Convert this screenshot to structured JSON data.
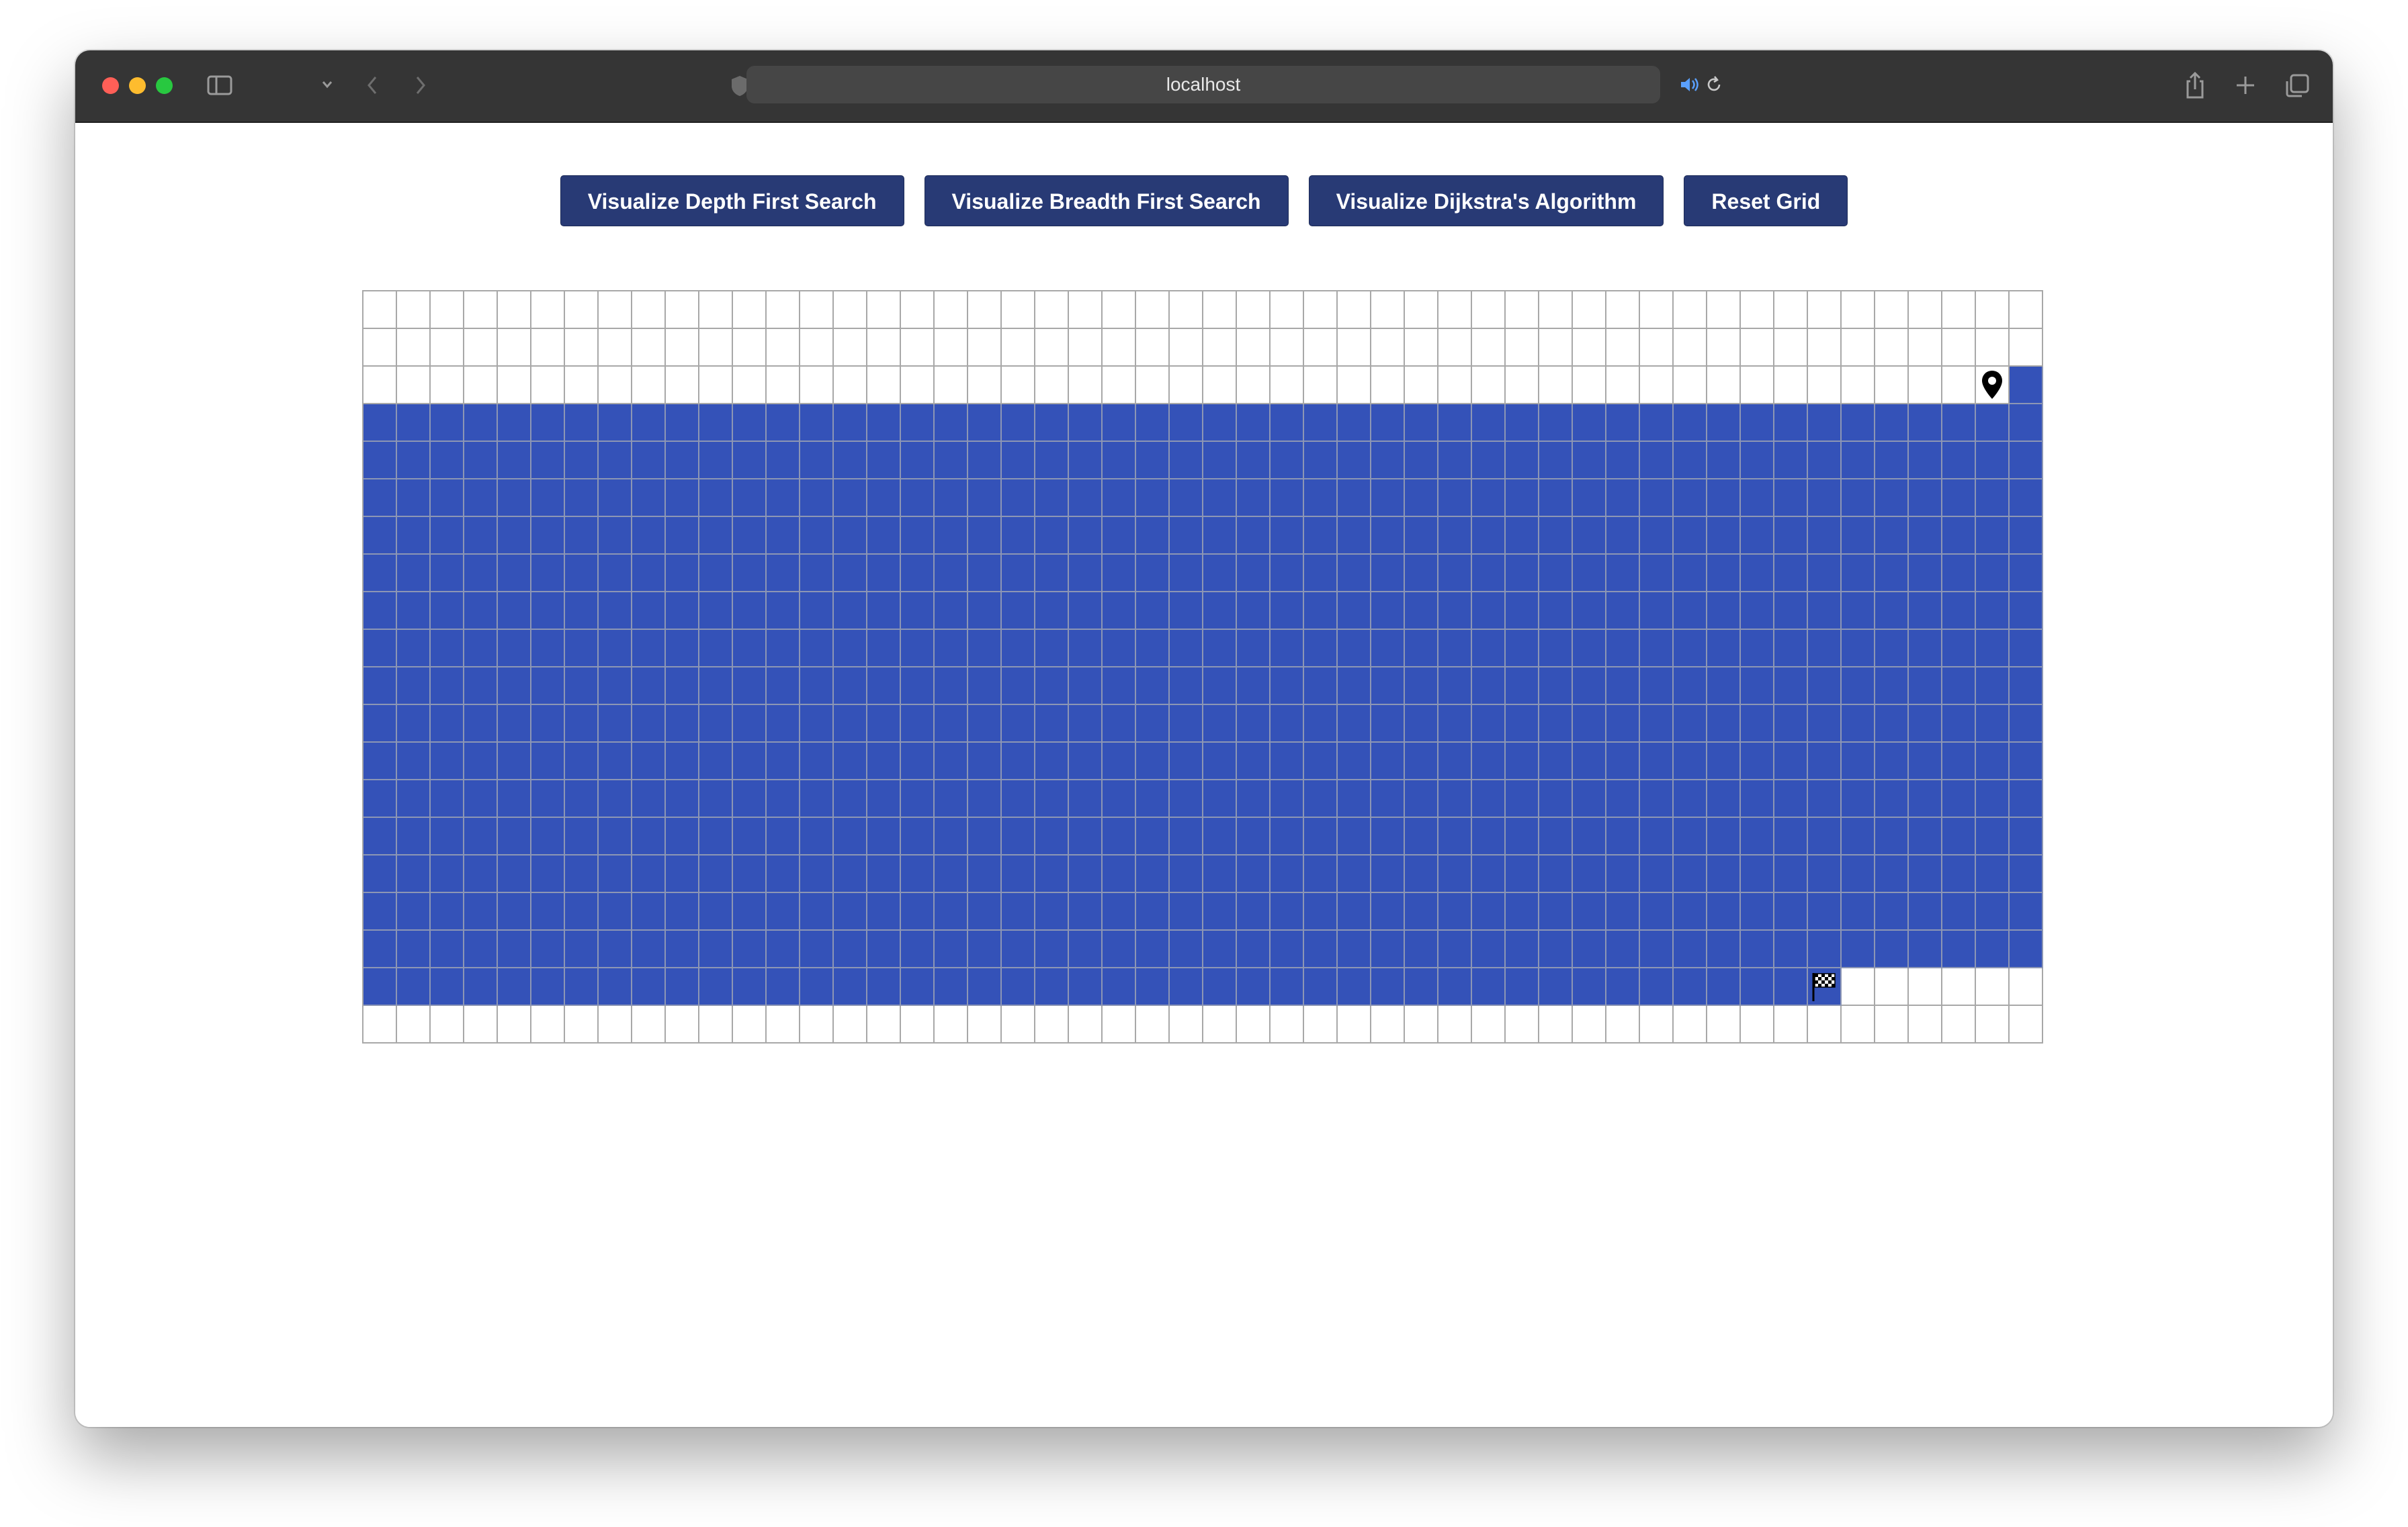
{
  "browser": {
    "url": "localhost",
    "icons": {
      "sidebar": "sidebar-icon",
      "back": "chevron-left-icon",
      "forward": "chevron-right-icon",
      "shield": "shield-icon",
      "extension": "extension-icon",
      "audio": "speaker-icon",
      "reload": "reload-icon",
      "share": "share-icon",
      "new_tab": "plus-icon",
      "tabs": "tabs-overview-icon"
    }
  },
  "toolbar": {
    "buttons": [
      {
        "label": "Visualize Depth First Search"
      },
      {
        "label": "Visualize Breadth First Search"
      },
      {
        "label": "Visualize Dijkstra's Algorithm"
      },
      {
        "label": "Reset Grid"
      }
    ]
  },
  "grid": {
    "rows": 20,
    "cols": 50,
    "start": {
      "row": 2,
      "col": 48,
      "icon": "location-pin-icon"
    },
    "finish": {
      "row": 18,
      "col": 43,
      "icon": "checkered-flag-icon"
    },
    "visited_from": {
      "row": 2,
      "col": 49
    },
    "visited_to": {
      "row": 18,
      "col": 42
    },
    "colors": {
      "visited": "#3452b8",
      "empty": "#ffffff",
      "button": "#283a75"
    }
  }
}
